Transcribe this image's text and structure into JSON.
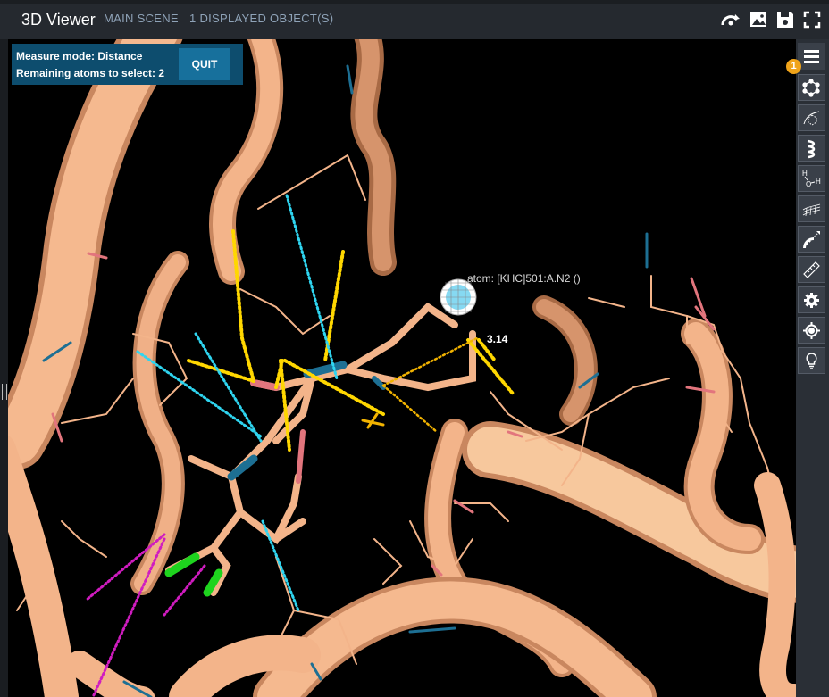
{
  "header": {
    "title": "3D Viewer",
    "scene_label": "MAIN SCENE",
    "objects_label": "1 DISPLAYED OBJECT(S)",
    "icons": [
      "rotate-icon",
      "image-icon",
      "save-icon",
      "fullscreen-icon"
    ]
  },
  "measure": {
    "mode_text": "Measure mode: Distance",
    "remaining_text": "Remaining atoms to select: 2",
    "quit_label": "QUIT"
  },
  "viewer": {
    "atom_label": "atom: [KHC]501:A.N2 ()",
    "distance_label": "3.14",
    "colors": {
      "ribbon": "#f5b98f",
      "carbon": "#f3b48a",
      "nitrogen": "#1d6f93",
      "oxygen": "#e2757d",
      "chlorine": "#1ed41e",
      "hbond": "#ffd700",
      "contact": "#2fd5f0",
      "halogen": "#d01cc0"
    }
  },
  "sidebar": {
    "badge_count": "1",
    "tools": [
      "menu-icon",
      "ball-stick-icon",
      "wireframe-icon",
      "cartoon-icon",
      "water-icon",
      "surface-icon",
      "distance-icon",
      "ruler-icon",
      "settings-icon",
      "center-icon",
      "light-icon"
    ]
  }
}
